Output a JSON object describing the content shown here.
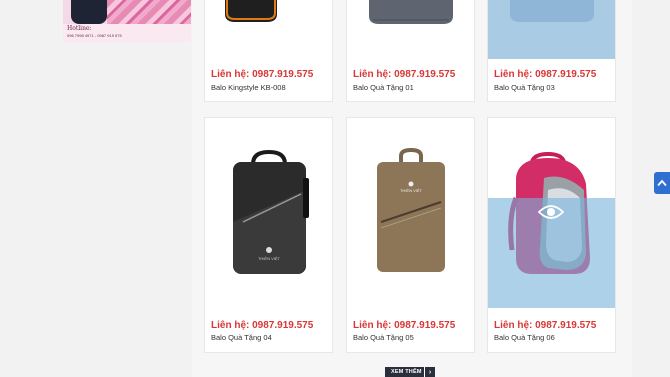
{
  "banner": {
    "brand_line": "Hotline:",
    "phone_line": "096 7998 4971 - 0987 919 575"
  },
  "products": [
    {
      "price": "Liên hệ: 0987.919.575",
      "name": "Balo Kingstyle KB-008"
    },
    {
      "price": "Liên hệ: 0987.919.575",
      "name": "Balo Quà Tặng 01"
    },
    {
      "price": "Liên hệ: 0987.919.575",
      "name": "Balo Quà Tặng 03"
    },
    {
      "price": "Liên hệ: 0987.919.575",
      "name": "Balo Quà Tặng 04"
    },
    {
      "price": "Liên hệ: 0987.919.575",
      "name": "Balo Quà Tặng 05"
    },
    {
      "price": "Liên hệ: 0987.919.575",
      "name": "Balo Quà Tặng 06"
    }
  ],
  "more_button": {
    "label": "XEM THÊM",
    "arrow": "›",
    "icon": "chevron-right-icon"
  },
  "scroll_top": {
    "icon": "chevron-up-icon"
  },
  "overlay_icon": "eye-icon",
  "colors": {
    "price": "#d93737",
    "overlay": "#78b2dc",
    "button": "#2a2f3d",
    "scroll_button": "#2f6fcf"
  }
}
